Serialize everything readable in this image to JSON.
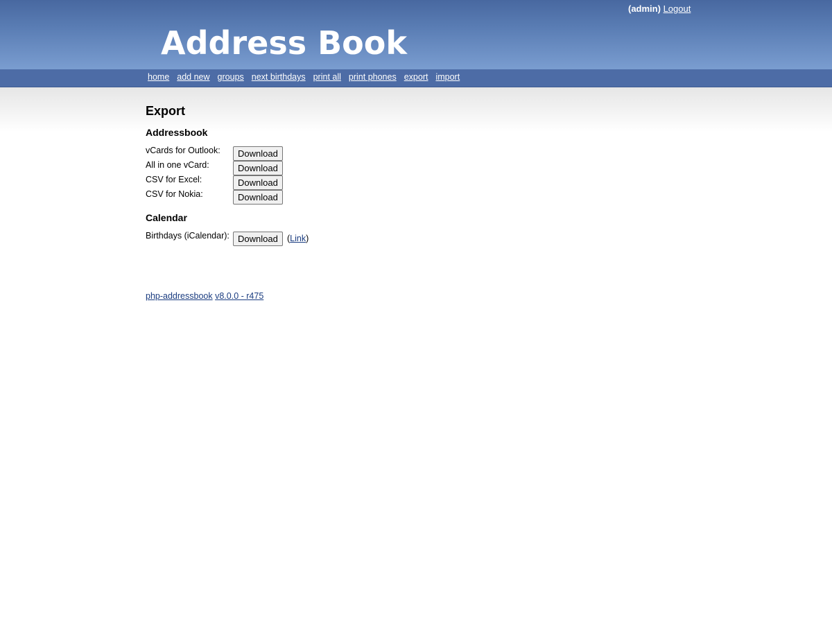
{
  "header": {
    "user": "(admin)",
    "logout_label": "Logout",
    "logo_text": "Address Book"
  },
  "nav": {
    "items": [
      {
        "label": "home"
      },
      {
        "label": "add new"
      },
      {
        "label": "groups"
      },
      {
        "label": "next birthdays"
      },
      {
        "label": "print all"
      },
      {
        "label": "print phones"
      },
      {
        "label": "export"
      },
      {
        "label": "import"
      }
    ]
  },
  "page": {
    "title": "Export",
    "addressbook": {
      "heading": "Addressbook",
      "rows": [
        {
          "label": "vCards for Outlook:",
          "button": "Download"
        },
        {
          "label": "All in one vCard:",
          "button": "Download"
        },
        {
          "label": "CSV for Excel:",
          "button": "Download"
        },
        {
          "label": "CSV for Nokia:",
          "button": "Download"
        }
      ]
    },
    "calendar": {
      "heading": "Calendar",
      "row": {
        "label": "Birthdays (iCalendar):",
        "button": "Download",
        "paren_open": "(",
        "link": "Link",
        "paren_close": ")"
      }
    }
  },
  "footer": {
    "project_link": "php-addressbook",
    "version_link": "v8.0.0 - r475"
  }
}
